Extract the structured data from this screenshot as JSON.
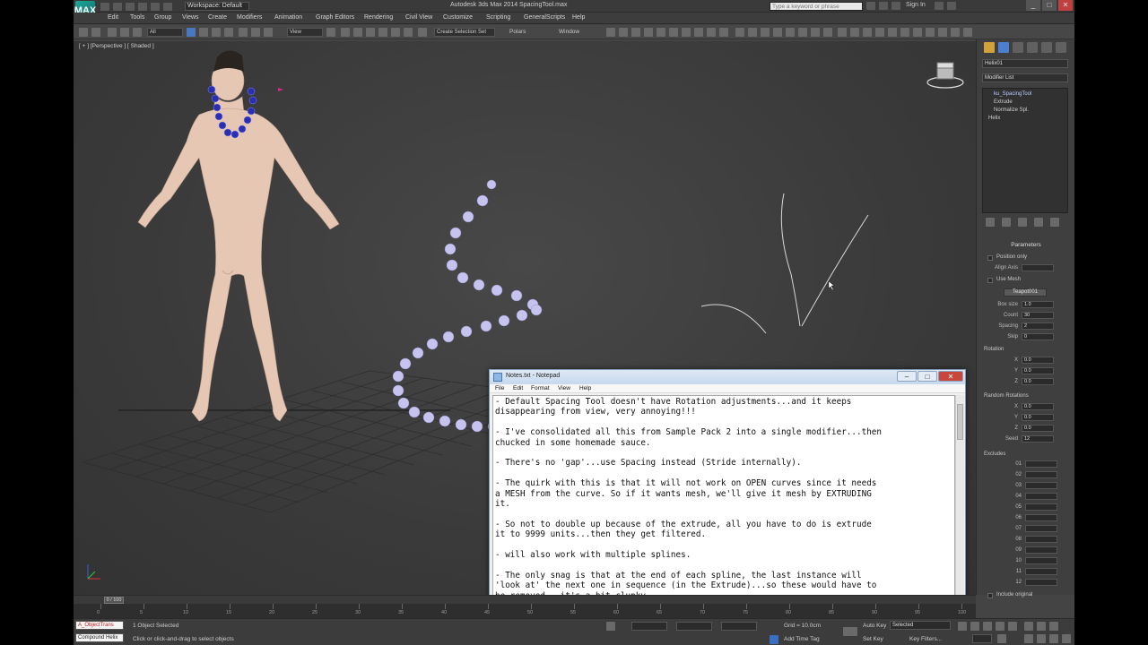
{
  "titlebar": {
    "logo_text": "MAX",
    "workspace": "Workspace: Default",
    "title": "Autodesk 3ds Max 2014    SpacingTool.max",
    "search_placeholder": "Type a keyword or phrase",
    "signin": "Sign In",
    "minimize": "_",
    "maximize": "□",
    "close": "✕"
  },
  "menubar": {
    "items": [
      "Edit",
      "Tools",
      "Group",
      "Views",
      "Create",
      "Modifiers",
      "Animation",
      "Graph Editors",
      "Rendering",
      "Civil View",
      "Customize",
      "Scripting",
      "GeneralScripts",
      "Help"
    ]
  },
  "toolbar": {
    "filter_dropdown": "All",
    "view_dropdown": "View",
    "selection_set": "Create Selection Set",
    "ref_label": "Polars",
    "window_label": "Window"
  },
  "viewport": {
    "label": "[ + ] [Perspective ] [ Shaded ]"
  },
  "cmdpanel": {
    "object_name": "Helix01",
    "modifier_list": "Modifier List",
    "stack": [
      "ku_SpacingTool",
      "Extrude",
      "Normalize Spl.",
      "Helix"
    ],
    "rollout_parameters": "Parameters",
    "position_only": "Position only",
    "align_axis_label": "Align Axis",
    "use_mesh_label": "Use Mesh",
    "teapot_btn": "Teapot001",
    "box_size_label": "Box size",
    "box_size": "1.0",
    "count_label": "Count",
    "count": "30",
    "spacing_label": "Spacing",
    "spacing": "2",
    "skip_label": "Skip",
    "skip": "0",
    "rotation_title": "Rotation",
    "rotation_x": "0.0",
    "rotation_y": "0.0",
    "rotation_z": "0.0",
    "random_title": "Random Rotations",
    "random_x": "0.0",
    "random_y": "0.0",
    "random_z": "0.0",
    "seed_label": "Seed",
    "seed": "12",
    "excludes_title": "Excludes",
    "include_original": "Include original"
  },
  "timeline": {
    "frame": "0 / 100",
    "ticks": [
      "0",
      "5",
      "10",
      "15",
      "20",
      "25",
      "30",
      "35",
      "40",
      "45",
      "50",
      "55",
      "60",
      "65",
      "70",
      "75",
      "80",
      "85",
      "90",
      "95",
      "100"
    ]
  },
  "statusbar": {
    "script_listener": "A_ObjectTrans",
    "maxscript": "Compound  Helix",
    "selected_text": "1 Object Selected",
    "prompt": "Click or click-and-drag to select objects",
    "grid": "Grid = 10.0cm",
    "auto_key": "Auto Key",
    "selected_dropdown": "Selected",
    "set_key": "Set Key",
    "key_filters": "Key Filters...",
    "add_time_tag": "Add Time Tag"
  },
  "notepad": {
    "title": "Notes.txt - Notepad",
    "menu": [
      "File",
      "Edit",
      "Format",
      "View",
      "Help"
    ],
    "lines": [
      "- Default Spacing Tool doesn't have Rotation adjustments...and it keeps",
      "disappearing from view, very annoying!!!",
      "",
      "- I've consolidated all this from Sample Pack 2 into a single modifier...then",
      "chucked in some homemade sauce.",
      "",
      "- There's no 'gap'...use Spacing instead (Stride internally).",
      "",
      "- The quirk with this is that it will not work on OPEN curves since it needs",
      "a MESH from the curve. So if it wants mesh, we'll give it mesh by EXTRUDING",
      "it.",
      "",
      "- So not to double up because of the extrude, all you have to do is extrude",
      "it to 9999 units...then they get filtered.",
      "",
      "- will also work with multiple splines.",
      "",
      "- The only snag is that at the end of each spline, the last instance will",
      "'look at' the next one in sequence (in the Extrude)...so these would have to",
      "be removed...it's a bit clunky..."
    ]
  }
}
